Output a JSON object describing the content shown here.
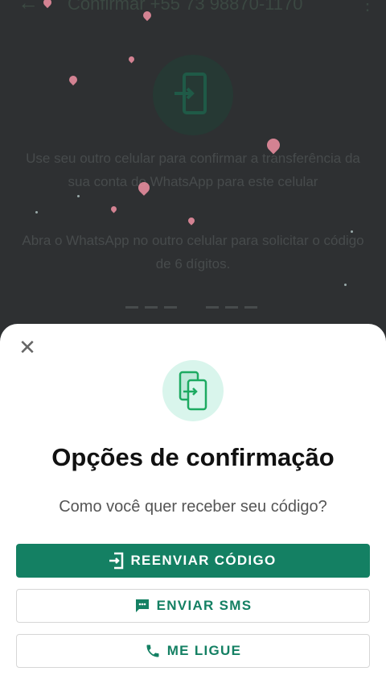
{
  "background": {
    "title": "Confirmar +55 73 98870-1170",
    "text_1": "Use seu outro celular para confirmar a transferência da sua conta do WhatsApp para este celular",
    "text_2": "Abra o WhatsApp no outro celular para solicitar o código de 6 dígitos."
  },
  "sheet": {
    "title": "Opções de confirmação",
    "subtitle": "Como você quer receber seu código?",
    "resend_label": "REENVIAR CÓDIGO",
    "sms_label": "ENVIAR SMS",
    "call_label": "ME LIGUE"
  },
  "colors": {
    "accent": "#148063",
    "icon_bg": "#d9f5ec",
    "icon_green": "#1daa61"
  },
  "icons": {
    "back": "arrow-left-icon",
    "more": "more-vertical-icon",
    "close": "close-icon",
    "transfer": "phone-transfer-icon",
    "sms": "message-icon",
    "call": "phone-icon"
  }
}
